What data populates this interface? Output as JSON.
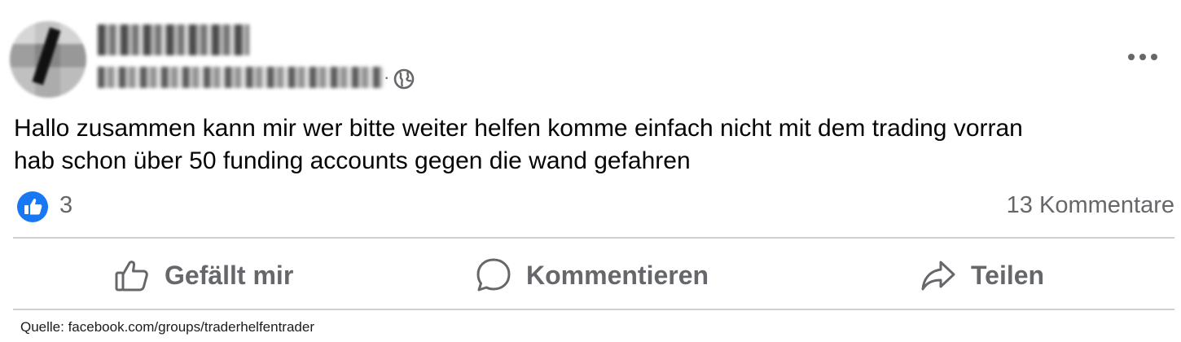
{
  "post": {
    "text_line1": "Hallo zusammen kann mir wer bitte weiter helfen komme einfach nicht mit dem trading vorran",
    "text_line2": "hab schon über 50 funding accounts gegen die wand gefahren",
    "meta_separator": "·",
    "audience_icon": "globe-icon",
    "reactions": {
      "icon": "thumbs-up-icon",
      "count": "3"
    },
    "comments_count": "13 Kommentare"
  },
  "actions": {
    "like": "Gefällt mir",
    "comment": "Kommentieren",
    "share": "Teilen"
  },
  "footer": {
    "source": "Quelle: facebook.com/groups/traderhelfentrader"
  },
  "colors": {
    "brand_blue": "#1877f2",
    "secondary_text": "#65676b",
    "divider": "#ced0d4"
  }
}
